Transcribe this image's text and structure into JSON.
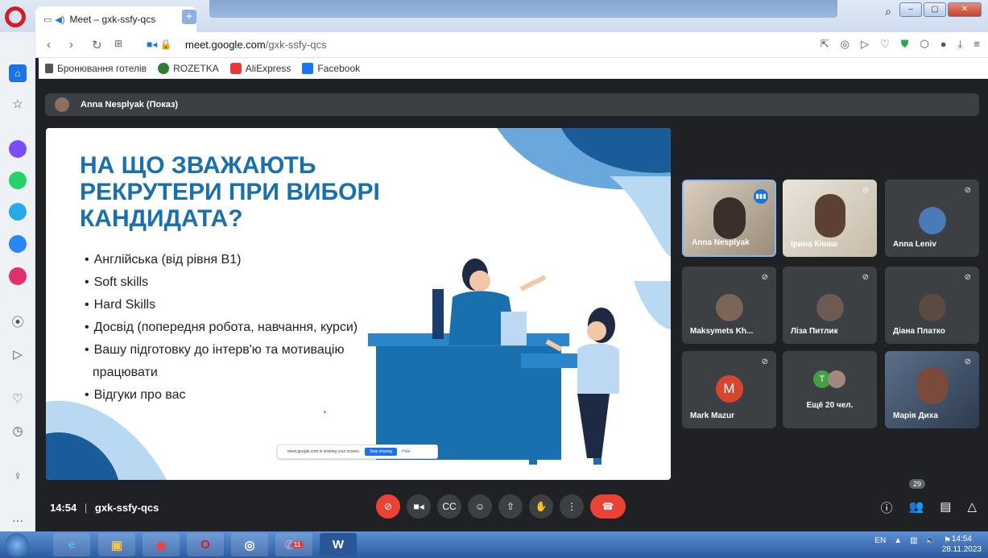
{
  "browser": {
    "tab_title": "Meet – gxk-ssfy-qcs",
    "tab_close": "✕",
    "new_tab": "+",
    "url_domain": "meet.google.com",
    "url_path": "/gxk-ssfy-qcs",
    "window_controls": {
      "minimize": "–",
      "maximize": "▢",
      "close": "✕"
    }
  },
  "bookmarks": [
    {
      "label": "Бронювання готелів",
      "color": "#333333"
    },
    {
      "label": "ROZETKA",
      "color": "#2e7d32"
    },
    {
      "label": "AliExpress",
      "color": "#e53935"
    },
    {
      "label": "Facebook",
      "color": "#1877f2"
    }
  ],
  "presenter": {
    "label": "Anna Nesplyak (Показ)"
  },
  "slide": {
    "title": "НА ЩО ЗВАЖАЮТЬ РЕКРУТЕРИ ПРИ ВИБОРІ КАНДИДАТА?",
    "bullets": [
      "Англійська (від рівня В1)",
      "Soft skills",
      "Hard Skills",
      "Досвід (попередня робота, навчання, курси)",
      "Вашу підготовку до інтерв'ю та мотивацію",
      "працювати",
      "Відгуки про вас"
    ],
    "share_notice": "meet.google.com is sharing your screen.",
    "stop_sharing": "Stop sharing",
    "hide": "Hide"
  },
  "participants": [
    {
      "name": "Anna Nesplyak"
    },
    {
      "name": "Ірина Кінаш"
    },
    {
      "name": "Anna Leniv"
    },
    {
      "name": "Maksymets Kh..."
    },
    {
      "name": "Ліза Питлик"
    },
    {
      "name": "Діана Платко"
    },
    {
      "name": "Mark Mazur",
      "initial": "M"
    },
    {
      "name": "Ещё 20 чел.",
      "initial": "T"
    },
    {
      "name": "Марія Диха"
    }
  ],
  "meeting": {
    "time": "14:54",
    "separator": "|",
    "code": "gxk-ssfy-qcs",
    "participant_count": "29"
  },
  "taskbar": {
    "lang": "EN",
    "time": "14:54",
    "date": "28.11.2023",
    "viber_badge": "11"
  },
  "colors": {
    "slide_title": "#1a6fae",
    "end_call": "#ea4335",
    "meet_bg": "#202124"
  }
}
